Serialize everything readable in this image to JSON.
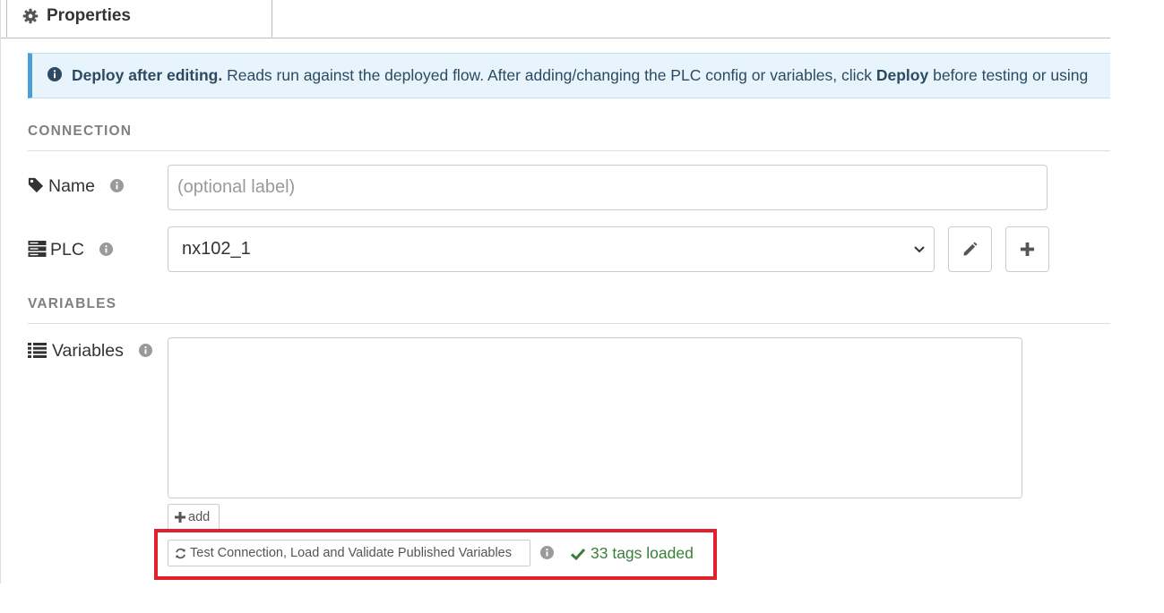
{
  "tab": {
    "label": "Properties",
    "icon": "gear-icon"
  },
  "info": {
    "bold_text": "Deploy after editing.",
    "text_before": "Reads run against the deployed flow. After adding/changing the PLC config or variables, click",
    "bold_deploy": "Deploy",
    "text_after": "before testing or using"
  },
  "sections": {
    "connection": "CONNECTION",
    "variables": "VARIABLES"
  },
  "fields": {
    "name": {
      "label": "Name",
      "placeholder": "(optional label)",
      "value": ""
    },
    "plc": {
      "label": "PLC",
      "selected": "nx102_1"
    },
    "variables": {
      "label": "Variables"
    }
  },
  "buttons": {
    "add_label": "add",
    "test_label": "Test Connection, Load and Validate Published Variables"
  },
  "status": {
    "text": "33 tags loaded"
  },
  "colors": {
    "info_bg": "#e8f4fb",
    "info_accent": "#4a9fd4",
    "success": "#3a7e3a",
    "highlight": "#e0202a"
  }
}
